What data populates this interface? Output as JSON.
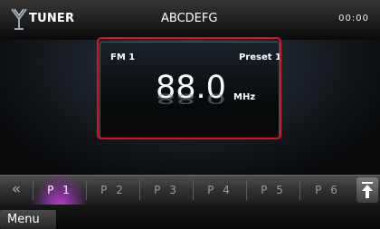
{
  "header": {
    "source_label": "TUNER",
    "source_icon": "antenna-icon",
    "station_name": "ABCDEFG",
    "clock": "00:00"
  },
  "display": {
    "band": "FM 1",
    "preset_label": "Preset 1",
    "frequency": "88.0",
    "unit": "MHz",
    "highlight_color": "#dd1122"
  },
  "presets": {
    "prev_symbol": "«",
    "items": [
      "P 1",
      "P 2",
      "P 3",
      "P 4",
      "P 5",
      "P 6"
    ],
    "active_index": 0,
    "active_color": "#c23ad6"
  },
  "footer": {
    "menu_label": "Menu"
  }
}
